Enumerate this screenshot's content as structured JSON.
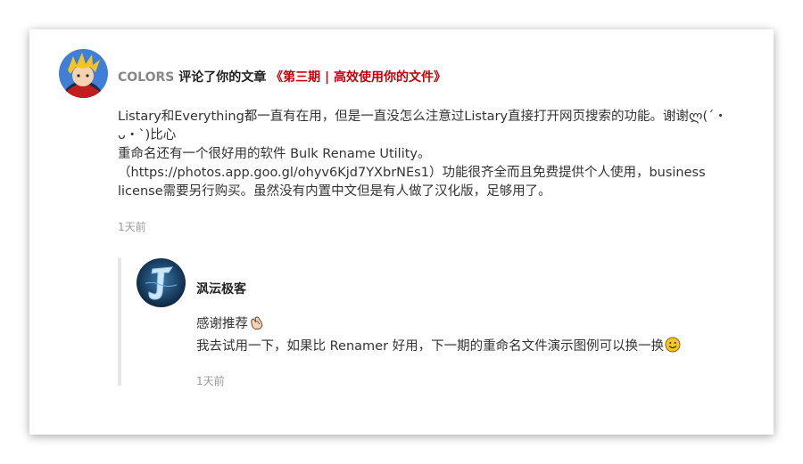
{
  "comment": {
    "user": "COLORS",
    "action": "评论了你的文章",
    "article_title": "《第三期 | 高效使用你的文件》",
    "lines": [
      "Listary和Everything都一直有在用，但是一直没怎么注意过Listary直接打开网页搜索的功能。谢谢ლ(´・ᴗ・`)比心",
      "重命名还有一个很好用的软件 Bulk Rename Utility。",
      "（https://photos.app.goo.gl/ohyv6Kjd7YXbrNEs1）功能很齐全而且免费提供个人使用，business license需要另行购买。虽然没有内置中文但是有人做了汉化版，足够用了。"
    ],
    "time": "1天前"
  },
  "reply": {
    "user": "沨沄极客",
    "line1": "感谢推荐",
    "line2": "我去试用一下，如果比 Renamer 好用，下一期的重命名文件演示图例可以换一换",
    "time": "1天前"
  },
  "colors": {
    "article_link": "#c7000b",
    "username": "#888888",
    "timestamp": "#999999"
  },
  "icons": {
    "reply_emoji_1": "clap-icon",
    "reply_emoji_2": "smile-emoji-icon"
  }
}
